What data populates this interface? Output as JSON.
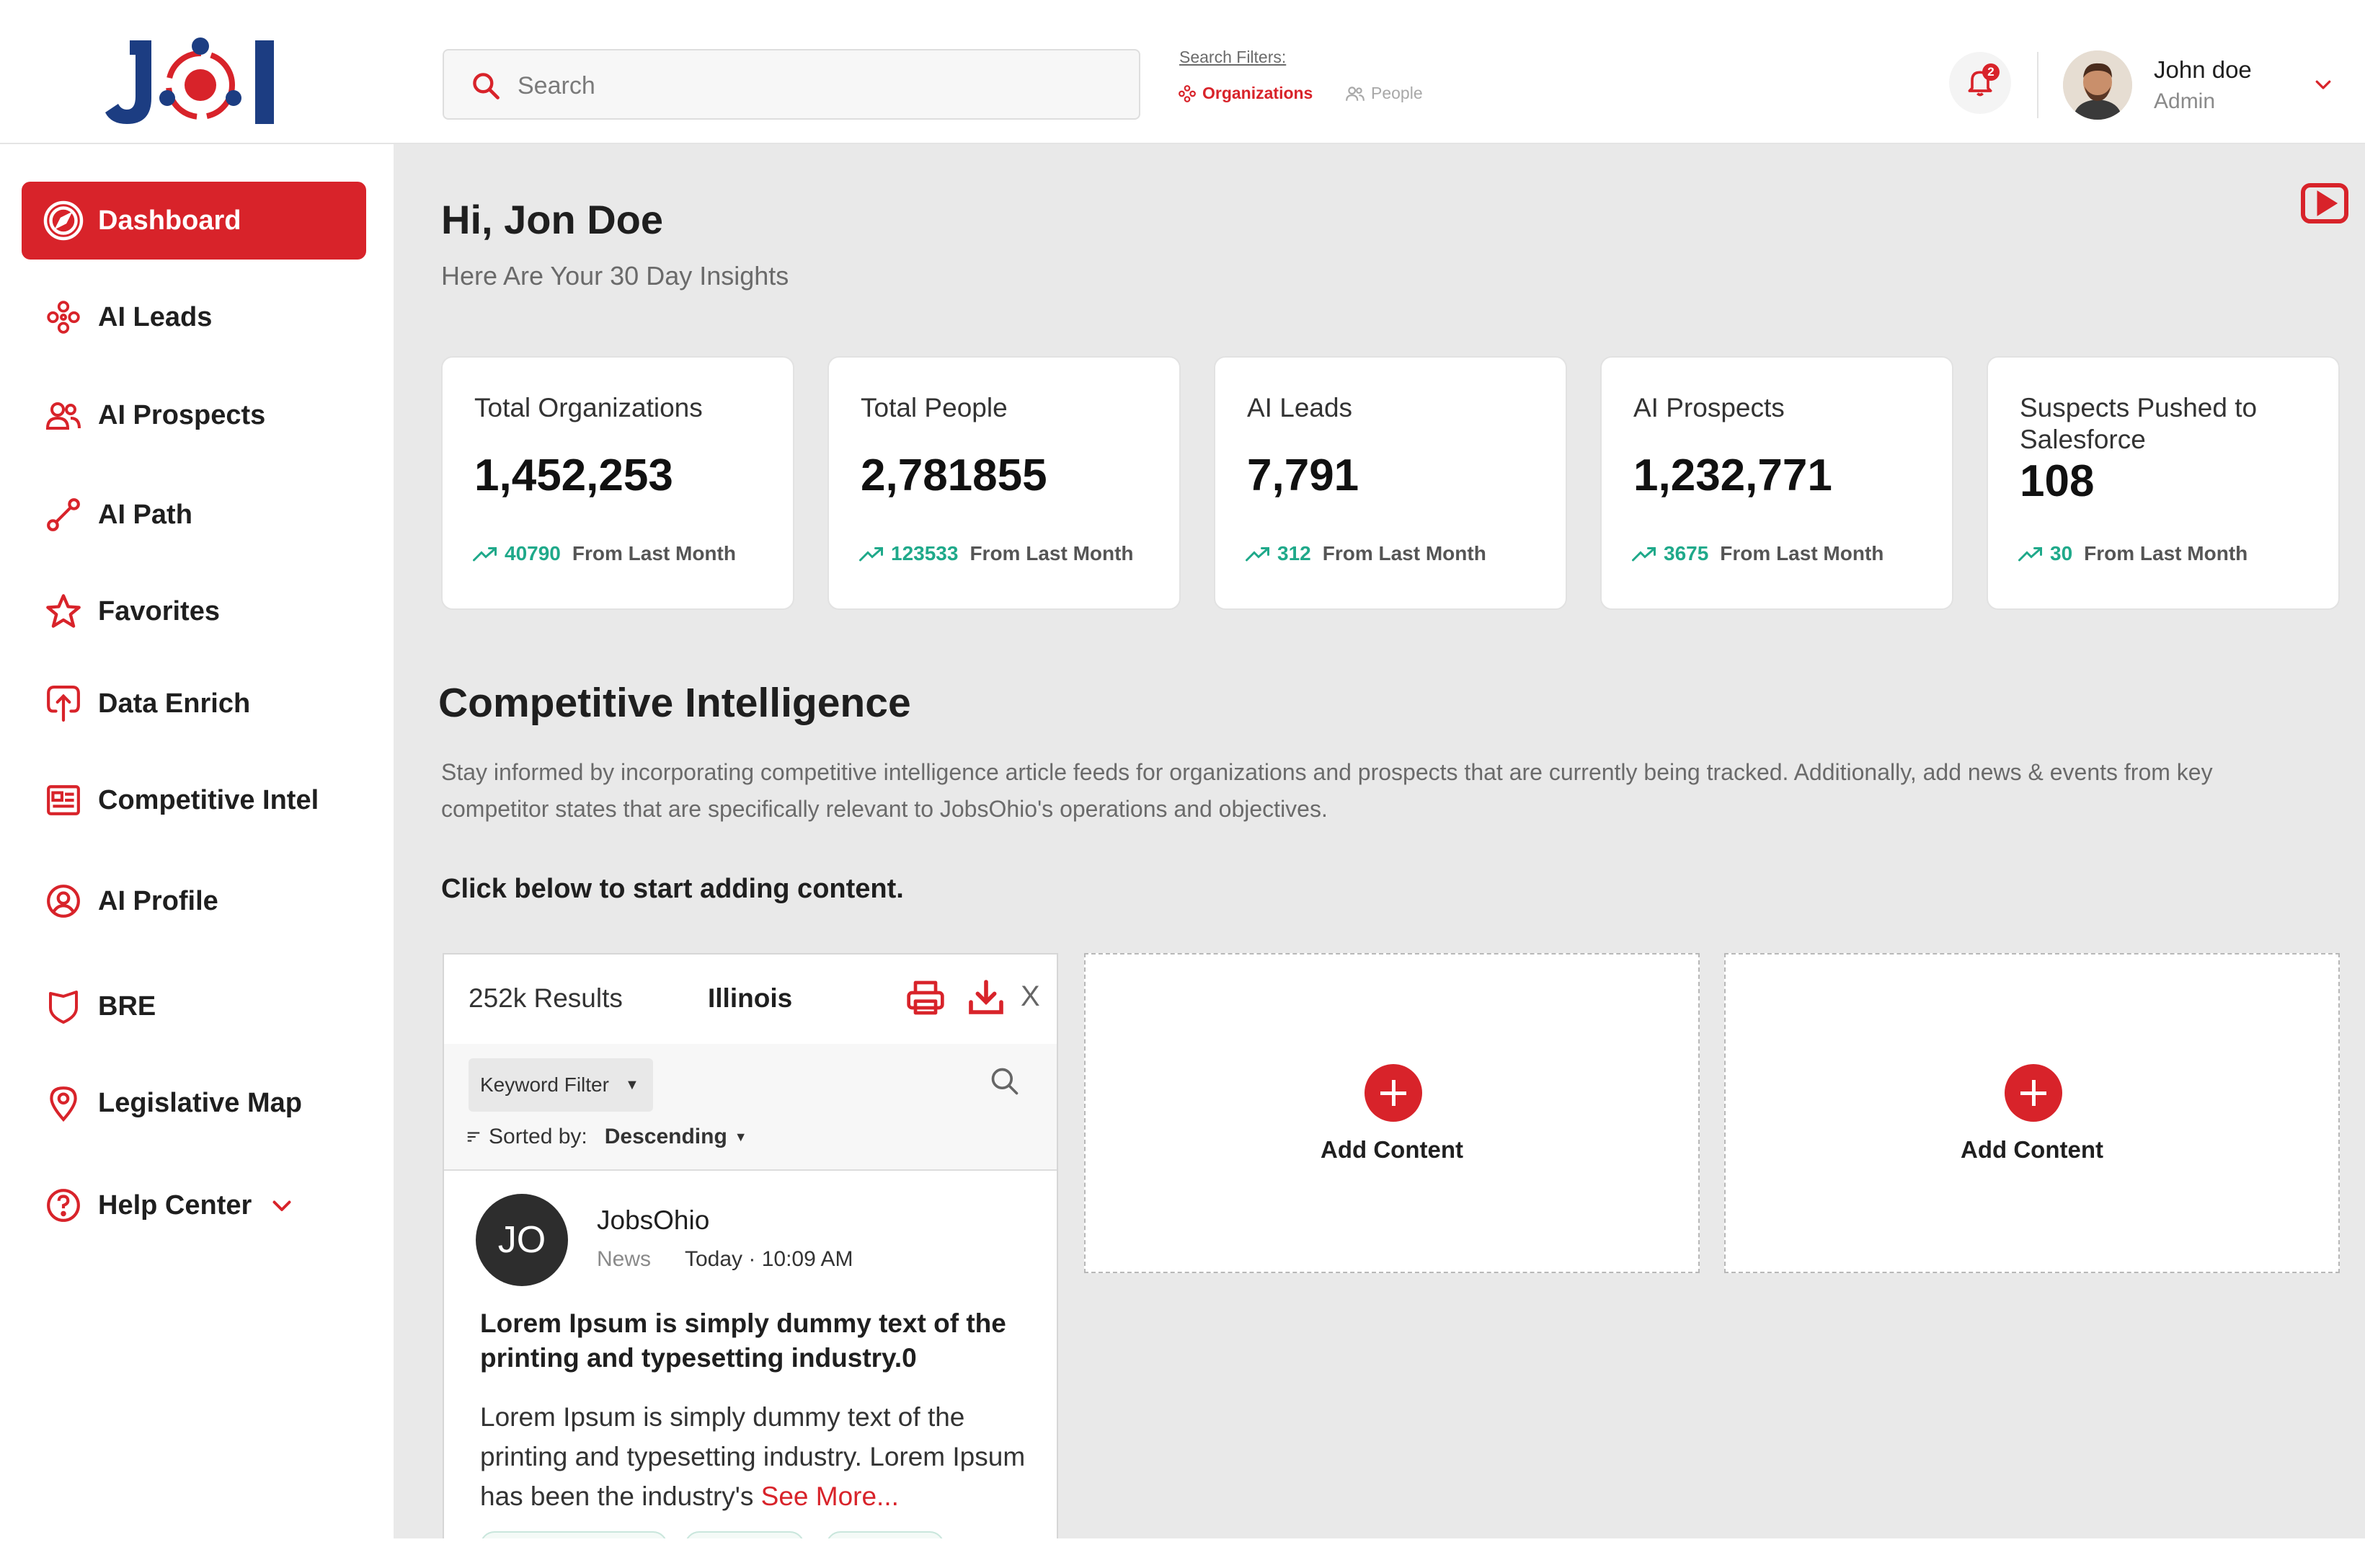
{
  "app": {
    "logo_text": "JOI"
  },
  "colors": {
    "brand_red": "#d8232a",
    "brand_navy": "#1c3d82",
    "trend_green": "#1fa98a",
    "main_bg": "#e9e9e9"
  },
  "header": {
    "search_placeholder": "Search",
    "search_filters_label": "Search Filters:",
    "filters": [
      {
        "label": "Organizations",
        "icon": "organizations-icon",
        "active": true
      },
      {
        "label": "People",
        "icon": "people-icon",
        "active": false
      }
    ],
    "notification_count": "2",
    "user": {
      "name": "John doe",
      "role": "Admin"
    }
  },
  "sidebar": {
    "items": [
      {
        "label": "Dashboard",
        "icon": "compass-icon",
        "active": true
      },
      {
        "label": "AI Leads",
        "icon": "network-icon"
      },
      {
        "label": "AI Prospects",
        "icon": "users-icon"
      },
      {
        "label": "AI Path",
        "icon": "path-icon"
      },
      {
        "label": "Favorites",
        "icon": "star-icon"
      },
      {
        "label": "Data Enrich",
        "icon": "upload-icon"
      },
      {
        "label": "Competitive Intel",
        "icon": "newspaper-icon"
      },
      {
        "label": "AI Profile",
        "icon": "profile-icon"
      },
      {
        "label": "BRE",
        "icon": "shield-icon"
      },
      {
        "label": "Legislative Map",
        "icon": "map-pin-icon"
      },
      {
        "label": "Help Center",
        "icon": "help-icon"
      }
    ]
  },
  "main": {
    "greeting": "Hi, Jon Doe",
    "sub_greeting": "Here Are Your 30 Day Insights",
    "stats": [
      {
        "label": "Total Organizations",
        "value": "1,452,253",
        "delta": "40790",
        "suffix": "From Last Month"
      },
      {
        "label": "Total People",
        "value": "2,781855",
        "delta": "123533",
        "suffix": "From Last Month"
      },
      {
        "label": "AI Leads",
        "value": "7,791",
        "delta": "312",
        "suffix": "From Last Month"
      },
      {
        "label": "AI Prospects",
        "value": "1,232,771",
        "delta": "3675",
        "suffix": "From Last Month"
      },
      {
        "label": "Suspects Pushed to Salesforce",
        "value": "108",
        "delta": "30",
        "suffix": "From Last Month"
      }
    ],
    "ci": {
      "title": "Competitive Intelligence",
      "description": "Stay informed by incorporating competitive intelligence article feeds for organizations and prospects that are currently being tracked. Additionally, add news & events from key competitor states that are specifically relevant to JobsOhio's operations and objectives.",
      "cta": "Click below to start adding content."
    },
    "feed": {
      "results": "252k Results",
      "state": "Illinois",
      "close": "X",
      "keyword_filter": "Keyword Filter",
      "sorted_by_label": "Sorted by:",
      "sort_value": "Descending",
      "post": {
        "avatar_initials": "JO",
        "source": "JobsOhio",
        "type": "News",
        "time": "Today · 10:09 AM",
        "title": "Lorem Ipsum is simply dummy text of the printing and typesetting industry.0",
        "body": "Lorem Ipsum is simply dummy text of the printing and typesetting industry. Lorem Ipsum has been the industry's",
        "see_more": "See More..."
      }
    },
    "add_content": [
      {
        "label": "Add Content"
      },
      {
        "label": "Add Content"
      }
    ]
  }
}
